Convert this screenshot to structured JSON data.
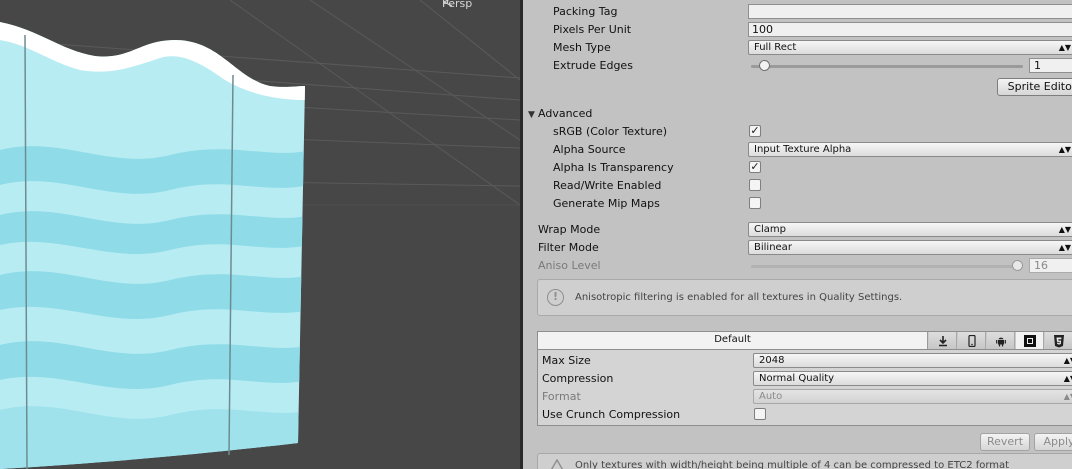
{
  "scene": {
    "camera_label": "Persp",
    "water_colors": {
      "light": "#b8ecf3",
      "mid": "#8fdce8",
      "dark": "#6fcfe0",
      "grid": "#5a5a5a",
      "background": "#474747",
      "line": "#6d8c92"
    }
  },
  "inspector": {
    "packing_tag": {
      "label": "Packing Tag",
      "value": ""
    },
    "pixels_per_unit": {
      "label": "Pixels Per Unit",
      "value": "100"
    },
    "mesh_type": {
      "label": "Mesh Type",
      "value": "Full Rect"
    },
    "extrude_edges": {
      "label": "Extrude Edges",
      "value": "1",
      "fraction": 0.03
    },
    "sprite_editor_button": "Sprite Editor",
    "advanced": {
      "label": "Advanced",
      "expanded": true,
      "srgb": {
        "label": "sRGB (Color Texture)",
        "checked": true
      },
      "alpha_source": {
        "label": "Alpha Source",
        "value": "Input Texture Alpha"
      },
      "alpha_is_transparency": {
        "label": "Alpha Is Transparency",
        "checked": true
      },
      "read_write": {
        "label": "Read/Write Enabled",
        "checked": false
      },
      "generate_mip_maps": {
        "label": "Generate Mip Maps",
        "checked": false
      }
    },
    "wrap_mode": {
      "label": "Wrap Mode",
      "value": "Clamp"
    },
    "filter_mode": {
      "label": "Filter Mode",
      "value": "Bilinear"
    },
    "aniso_level": {
      "label": "Aniso Level",
      "value": "16",
      "fraction": 1.0
    },
    "aniso_help": "Anisotropic filtering is enabled for all textures in Quality Settings.",
    "platform": {
      "default_tab": "Default",
      "tab_icons": [
        "download-icon",
        "mobile-icon",
        "android-icon",
        "windows-store-icon",
        "html5-icon"
      ],
      "max_size": {
        "label": "Max Size",
        "value": "2048"
      },
      "compression": {
        "label": "Compression",
        "value": "Normal Quality"
      },
      "format": {
        "label": "Format",
        "value": "Auto"
      },
      "use_crunch": {
        "label": "Use Crunch Compression",
        "checked": false
      }
    },
    "revert_button": "Revert",
    "apply_button": "Apply",
    "etc2_warning": "Only textures with width/height being multiple of 4 can be compressed to ETC2 format"
  }
}
